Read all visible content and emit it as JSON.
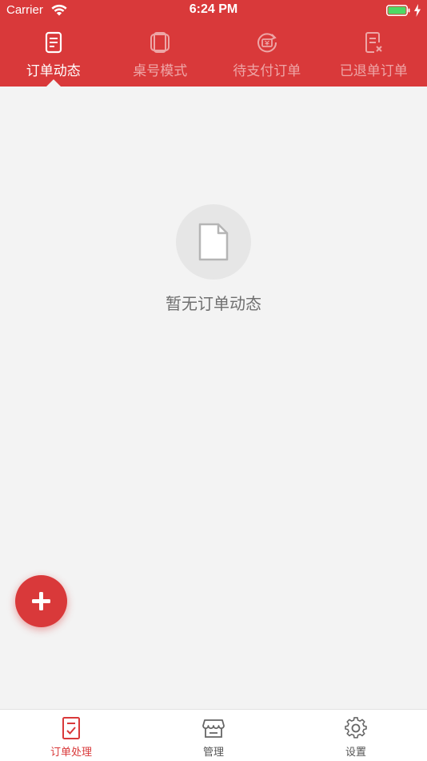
{
  "status_bar": {
    "carrier": "Carrier",
    "time": "6:24 PM",
    "battery_level": 1.0,
    "charging": true,
    "icons": [
      "wifi-icon",
      "battery-icon",
      "charging-bolt-icon"
    ]
  },
  "top_tabs": [
    {
      "label": "订单动态",
      "icon": "order-list-icon",
      "active": true
    },
    {
      "label": "桌号模式",
      "icon": "table-icon",
      "active": false
    },
    {
      "label": "待支付订单",
      "icon": "pending-payment-icon",
      "active": false
    },
    {
      "label": "已退单订单",
      "icon": "refunded-order-icon",
      "active": false
    }
  ],
  "empty_state": {
    "icon": "blank-document-icon",
    "message": "暂无订单动态"
  },
  "fab": {
    "icon": "plus-icon"
  },
  "bottom_nav": [
    {
      "label": "订单处理",
      "icon": "order-check-icon",
      "active": true
    },
    {
      "label": "管理",
      "icon": "store-icon",
      "active": false
    },
    {
      "label": "设置",
      "icon": "gear-icon",
      "active": false
    }
  ],
  "colors": {
    "brand_red": "#d9393a",
    "background": "#f3f3f3",
    "battery_green": "#4cd964"
  }
}
